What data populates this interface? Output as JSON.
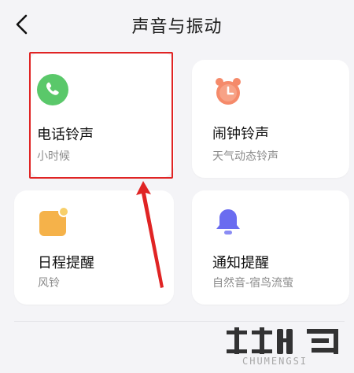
{
  "header": {
    "title": "声音与振动",
    "back_icon": "chevron-left-icon"
  },
  "cards": [
    {
      "label": "电话铃声",
      "sub": "小时候",
      "icon": "phone-icon",
      "color": "#5ac86a"
    },
    {
      "label": "闹钟铃声",
      "sub": "天气动态铃声",
      "icon": "alarm-clock-icon",
      "color": "#f58a6a"
    },
    {
      "label": "日程提醒",
      "sub": "风铃",
      "icon": "calendar-icon",
      "color": "#f5b24a"
    },
    {
      "label": "通知提醒",
      "sub": "自然音-宿鸟流萤",
      "icon": "bell-icon",
      "color": "#6a6cf0"
    }
  ],
  "annotation": {
    "highlight_color": "#e02424"
  },
  "watermark": {
    "text": "CHUMENGSI",
    "logo": "chumengsi-logo"
  }
}
